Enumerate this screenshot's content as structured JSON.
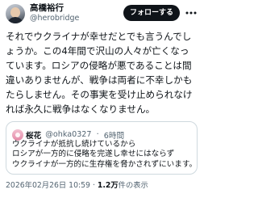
{
  "author": {
    "name": "高橋裕行",
    "handle": "@herobridge"
  },
  "header": {
    "follow_label": "フォローする",
    "more_icon": "more-horizontal-icon"
  },
  "tweet": {
    "lines": [
      "それでウクライナが幸せだとでも言うんでし",
      "ょうか。この4年間で沢山の人々が亡くなっ",
      "ています。ロシアの侵略が悪であることは間",
      "違いありませんが、戦争は両者に不幸しかも",
      "たらしません。その事実を受け止められなけ",
      "れば永久に戦争はなくなりません。"
    ]
  },
  "quoted": {
    "name": "桜花",
    "handle": "@ohka0327",
    "separator": "·",
    "time": "6時間",
    "lines": [
      "ウクライナが抵抗し続けているから",
      "ロシアが一方的に侵略を完遂し幸せにはならず",
      "ウクライナが一方的に生存権を脅かされずにいます。",
      "..."
    ]
  },
  "meta": {
    "timestamp": "2026年02月26日 10:59",
    "separator": "·",
    "views_count": "1.2万",
    "views_label": "件の表示"
  },
  "colors": {
    "text": "#0f1419",
    "secondary": "#536471",
    "border": "#cfd9de",
    "button_bg": "#0f1419",
    "button_text": "#ffffff"
  }
}
